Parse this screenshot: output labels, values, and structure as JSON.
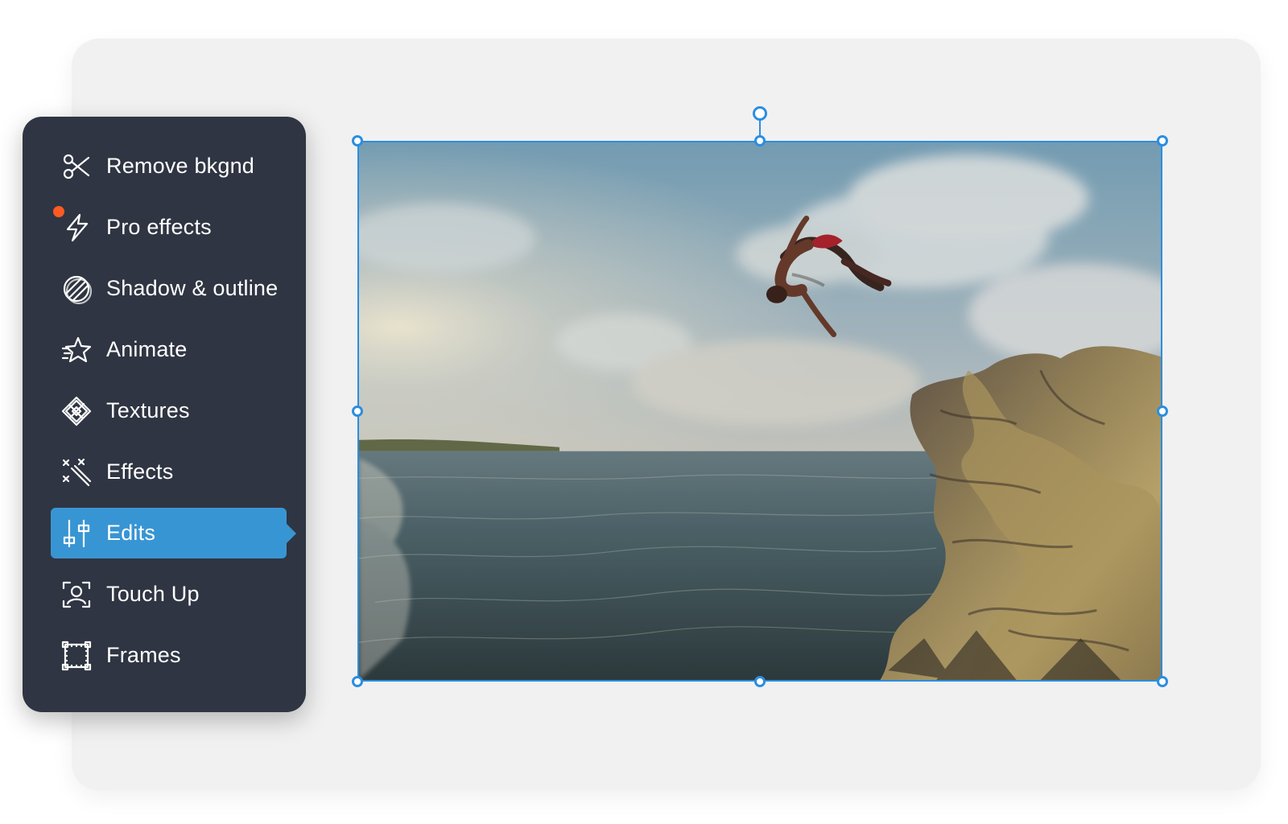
{
  "menu": {
    "items": [
      {
        "label": "Remove bkgnd",
        "icon": "scissors-icon"
      },
      {
        "label": "Pro effects",
        "icon": "lightning-icon",
        "badge": "new-dot"
      },
      {
        "label": "Shadow & outline",
        "icon": "shadow-outline-icon"
      },
      {
        "label": "Animate",
        "icon": "star-motion-icon"
      },
      {
        "label": "Textures",
        "icon": "texture-icon"
      },
      {
        "label": "Effects",
        "icon": "magic-wand-icon"
      },
      {
        "label": "Edits",
        "icon": "sliders-icon",
        "selected": true
      },
      {
        "label": "Touch Up",
        "icon": "face-scan-icon"
      },
      {
        "label": "Frames",
        "icon": "frame-icon"
      }
    ]
  },
  "colors": {
    "menu_background": "#2f3542",
    "selected_background": "#3895d3",
    "selection_accent": "#2b8ee0",
    "notification_dot": "#ff5a24",
    "canvas_background": "#f1f1f2"
  },
  "image": {
    "description": "cliff diver above the sea"
  }
}
